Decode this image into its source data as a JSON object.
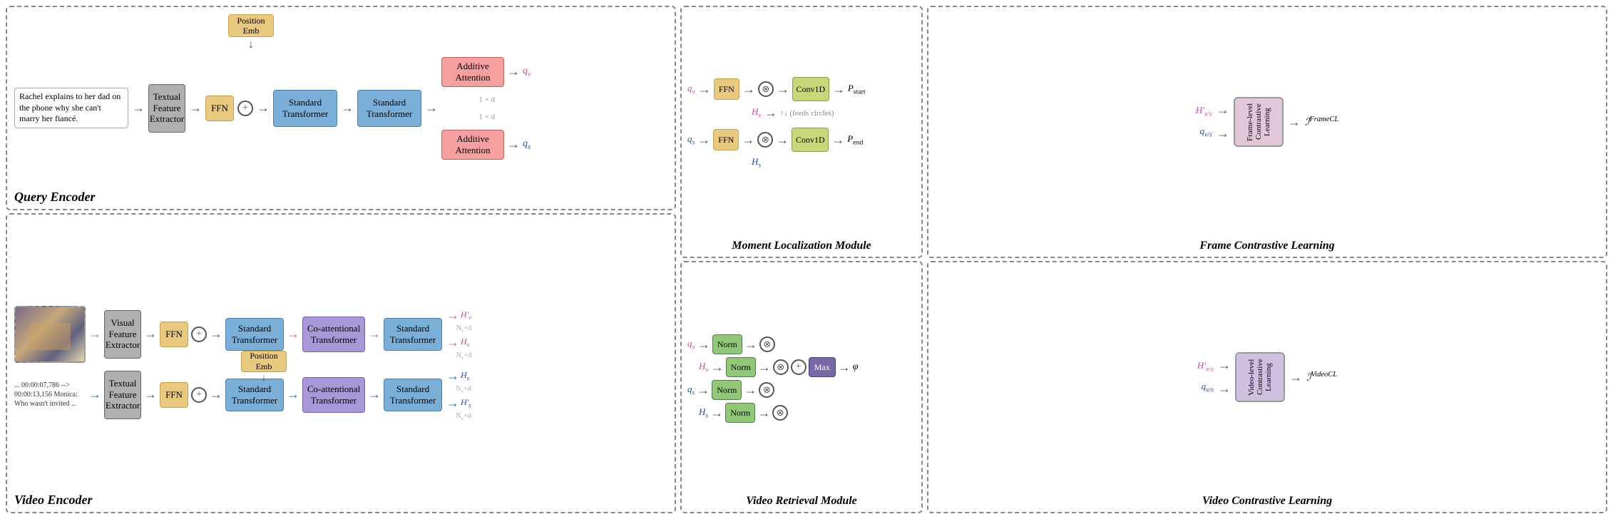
{
  "query_encoder": {
    "label": "Query Encoder",
    "query_text": "Rachel explains to her dad on the phone why she can't marry her fiancé.",
    "textual_extractor": "Textual Feature Extractor",
    "ffn": "FFN",
    "standard_transformer1": "Standard Transformer",
    "standard_transformer2": "Standard Transformer",
    "position_emb": "Position Emb",
    "additive_attention1": "Additive Attention",
    "additive_attention2": "Additive Attention",
    "qv_label": "q_v",
    "qs_label": "q_s",
    "dim1": "1 × d",
    "dim2": "1 × d"
  },
  "video_encoder": {
    "label": "Video Encoder",
    "visual_extractor": "Visual Feature Extractor",
    "textual_extractor": "Textual Feature Extractor",
    "ffn1": "FFN",
    "ffn2": "FFN",
    "position_emb": "Position Emb",
    "standard_transformer1": "Standard Transformer",
    "standard_transformer2": "Standard Transformer",
    "standard_transformer3": "Standard Transformer",
    "standard_transformer4": "Standard Transformer",
    "co_attn_transformer1": "Co-attentional Transformer",
    "co_attn_transformer2": "Co-attentional Transformer",
    "Hv_prime": "H'_v",
    "Hv": "H_v",
    "Hs": "H_s",
    "Hs_prime": "H'_s",
    "Nv_d1": "N_v × d",
    "Nv_d2": "N_v × d",
    "Nv_d3": "N_v × d",
    "Nv_d4": "N_v × d",
    "subtitle": "... 00:00:07,786 --> 00:00:13,156 Monica: Who wasn't invited ..."
  },
  "moment_localization": {
    "label": "Moment Localization Module",
    "qv": "q_v",
    "qs": "q_s",
    "Hv": "H_v",
    "Hs": "H_s",
    "ffn1": "FFN",
    "ffn2": "FFN",
    "conv1d_1": "Conv1D",
    "conv1d_2": "Conv1D",
    "p_start": "P_start",
    "p_end": "P_end"
  },
  "frame_contrastive": {
    "label": "Frame Contrastive Learning",
    "Hv_prime": "H'_{v/s}",
    "qvs": "q_{v/s}",
    "output": "ℐ^{FrameCL}",
    "cl_label": "Frame-level Contrastive Learning"
  },
  "video_retrieval": {
    "label": "Video Retrieval Module",
    "qv": "q_v",
    "Hv": "H_v",
    "qs": "q_s",
    "Hs": "H_s",
    "norm1": "Norm",
    "norm2": "Norm",
    "norm3": "Norm",
    "norm4": "Norm",
    "max_label": "Max",
    "phi": "φ"
  },
  "video_contrastive": {
    "label": "Video Contrastive Learning",
    "Hv_prime": "H'_{v/s}",
    "qvs": "q_{v/s}",
    "output": "ℐ^{VideoCL}",
    "cl_label": "Video-level Contrastive Learning"
  }
}
